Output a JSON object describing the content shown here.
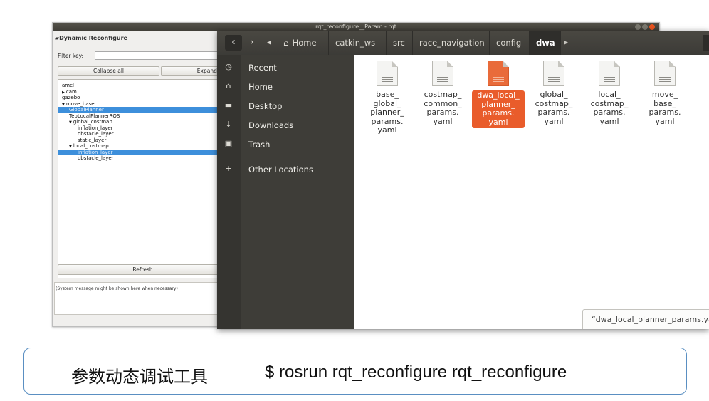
{
  "rqt": {
    "window_title": "rqt_reconfigure__Param - rqt",
    "panel_title": "Dynamic Reconfigure",
    "filter_label": "Filter key:",
    "filter_value": "",
    "collapse_all": "Collapse all",
    "expand_all": "Expand all",
    "tree": [
      {
        "label": "amcl",
        "level": 0,
        "arrow": "",
        "selected": false
      },
      {
        "label": "cam",
        "level": 0,
        "arrow": "▶",
        "selected": false
      },
      {
        "label": "gazebo",
        "level": 0,
        "arrow": "",
        "selected": false
      },
      {
        "label": "move_base",
        "level": 0,
        "arrow": "▼",
        "selected": false
      },
      {
        "label": "GlobalPlanner",
        "level": 1,
        "arrow": "",
        "selected": true
      },
      {
        "label": "TebLocalPlannerROS",
        "level": 1,
        "arrow": "",
        "selected": false
      },
      {
        "label": "global_costmap",
        "level": 1,
        "arrow": "▼",
        "selected": false
      },
      {
        "label": "inflation_layer",
        "level": 2,
        "arrow": "",
        "selected": false
      },
      {
        "label": "obstacle_layer",
        "level": 2,
        "arrow": "",
        "selected": false
      },
      {
        "label": "static_layer",
        "level": 2,
        "arrow": "",
        "selected": false
      },
      {
        "label": "local_costmap",
        "level": 1,
        "arrow": "▼",
        "selected": false
      },
      {
        "label": "inflation_layer",
        "level": 2,
        "arrow": "",
        "selected": true
      },
      {
        "label": "obstacle_layer",
        "level": 2,
        "arrow": "",
        "selected": false
      }
    ],
    "refresh": "Refresh",
    "system_message": "(System message might be shown here when necessary)"
  },
  "files": {
    "breadcrumbs": [
      "Home",
      "catkin_ws",
      "src",
      "race_navigation",
      "config",
      "dwa"
    ],
    "active_crumb": "dwa",
    "sidebar": [
      {
        "label": "Recent",
        "icon": "clock-icon",
        "glyph": "◷"
      },
      {
        "label": "Home",
        "icon": "home-icon",
        "glyph": "⌂"
      },
      {
        "label": "Desktop",
        "icon": "desktop-icon",
        "glyph": "▬"
      },
      {
        "label": "Downloads",
        "icon": "download-icon",
        "glyph": "↓"
      },
      {
        "label": "Trash",
        "icon": "trash-icon",
        "glyph": "▣"
      },
      {
        "label": "Other Locations",
        "icon": "plus-icon",
        "glyph": "+"
      }
    ],
    "items": [
      {
        "name": "base_\nglobal_\nplanner_\nparams.\nyaml",
        "selected": false
      },
      {
        "name": "costmap_\ncommon_\nparams.\nyaml",
        "selected": false
      },
      {
        "name": "dwa_local_\nplanner_\nparams.\nyaml",
        "selected": true
      },
      {
        "name": "global_\ncostmap_\nparams.\nyaml",
        "selected": false
      },
      {
        "name": "local_\ncostmap_\nparams.\nyaml",
        "selected": false
      },
      {
        "name": "move_\nbase_\nparams.\nyaml",
        "selected": false
      }
    ],
    "status": "“dwa_local_planner_params.yaml”"
  },
  "caption": {
    "chinese": "参数动态调试工具",
    "command": "$ rosrun rqt_reconfigure rqt_reconfigure"
  }
}
